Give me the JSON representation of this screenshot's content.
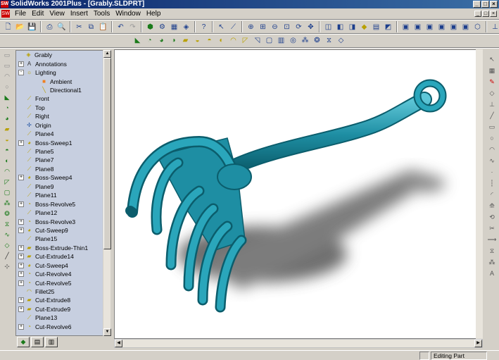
{
  "window": {
    "title": "SolidWorks 2001Plus - [Grably.SLDPRT]",
    "app_icon_text": "SW",
    "controls": [
      "_",
      "□",
      "×"
    ]
  },
  "menu": {
    "items": [
      "File",
      "Edit",
      "View",
      "Insert",
      "Tools",
      "Window",
      "Help"
    ],
    "doc_controls": [
      "_",
      "□",
      "×"
    ]
  },
  "feature_tree": {
    "items": [
      {
        "label": "Grably",
        "icon": "part-icon",
        "indent": 0,
        "expand": ""
      },
      {
        "label": "Annotations",
        "icon": "annotations-icon",
        "indent": 1,
        "expand": "+"
      },
      {
        "label": "Lighting",
        "icon": "lighting-icon",
        "indent": 1,
        "expand": "-"
      },
      {
        "label": "Ambient",
        "icon": "ambient-light-icon",
        "indent": 2,
        "expand": ""
      },
      {
        "label": "Directional1",
        "icon": "directional-light-icon",
        "indent": 2,
        "expand": ""
      },
      {
        "label": "Front",
        "icon": "plane-icon",
        "indent": 1,
        "expand": ""
      },
      {
        "label": "Top",
        "icon": "plane-icon",
        "indent": 1,
        "expand": ""
      },
      {
        "label": "Right",
        "icon": "plane-icon",
        "indent": 1,
        "expand": ""
      },
      {
        "label": "Origin",
        "icon": "origin-icon",
        "indent": 1,
        "expand": ""
      },
      {
        "label": "Plane4",
        "icon": "plane-icon",
        "indent": 1,
        "expand": ""
      },
      {
        "label": "Boss-Sweep1",
        "icon": "sweep-icon",
        "indent": 1,
        "expand": "+"
      },
      {
        "label": "Plane5",
        "icon": "plane-icon",
        "indent": 1,
        "expand": ""
      },
      {
        "label": "Plane7",
        "icon": "plane-icon",
        "indent": 1,
        "expand": ""
      },
      {
        "label": "Plane8",
        "icon": "plane-icon",
        "indent": 1,
        "expand": ""
      },
      {
        "label": "Boss-Sweep4",
        "icon": "sweep-icon",
        "indent": 1,
        "expand": "+"
      },
      {
        "label": "Plane9",
        "icon": "plane-icon",
        "indent": 1,
        "expand": ""
      },
      {
        "label": "Plane11",
        "icon": "plane-icon",
        "indent": 1,
        "expand": ""
      },
      {
        "label": "Boss-Revolve5",
        "icon": "revolve-icon",
        "indent": 1,
        "expand": "+"
      },
      {
        "label": "Plane12",
        "icon": "plane-icon",
        "indent": 1,
        "expand": ""
      },
      {
        "label": "Boss-Revolve3",
        "icon": "revolve-icon",
        "indent": 1,
        "expand": "+"
      },
      {
        "label": "Cut-Sweep9",
        "icon": "sweep-icon",
        "indent": 1,
        "expand": "+"
      },
      {
        "label": "Plane15",
        "icon": "plane-icon",
        "indent": 1,
        "expand": ""
      },
      {
        "label": "Boss-Extrude-Thin1",
        "icon": "extrude-icon",
        "indent": 1,
        "expand": "+"
      },
      {
        "label": "Cut-Extrude14",
        "icon": "extrude-icon",
        "indent": 1,
        "expand": "+"
      },
      {
        "label": "Cut-Sweep4",
        "icon": "sweep-icon",
        "indent": 1,
        "expand": "+"
      },
      {
        "label": "Cut-Revolve4",
        "icon": "revolve-icon",
        "indent": 1,
        "expand": "+"
      },
      {
        "label": "Cut-Revolve5",
        "icon": "revolve-icon",
        "indent": 1,
        "expand": "+"
      },
      {
        "label": "Fillet25",
        "icon": "fillet-icon",
        "indent": 1,
        "expand": ""
      },
      {
        "label": "Cut-Extrude8",
        "icon": "extrude-icon",
        "indent": 1,
        "expand": "+"
      },
      {
        "label": "Cut-Extrude9",
        "icon": "extrude-icon",
        "indent": 1,
        "expand": "+"
      },
      {
        "label": "Plane13",
        "icon": "plane-icon",
        "indent": 1,
        "expand": ""
      },
      {
        "label": "Cut-Revolve6",
        "icon": "revolve-icon",
        "indent": 1,
        "expand": "+"
      }
    ]
  },
  "tree_tabs": [
    "featuremanager-tab",
    "propertymanager-tab",
    "configmanager-tab"
  ],
  "status": {
    "mode": "Editing Part"
  },
  "colors": {
    "model": "#1e8ea3",
    "tree_bg": "#c7cfe0",
    "title_gradient_start": "#0a246a"
  }
}
